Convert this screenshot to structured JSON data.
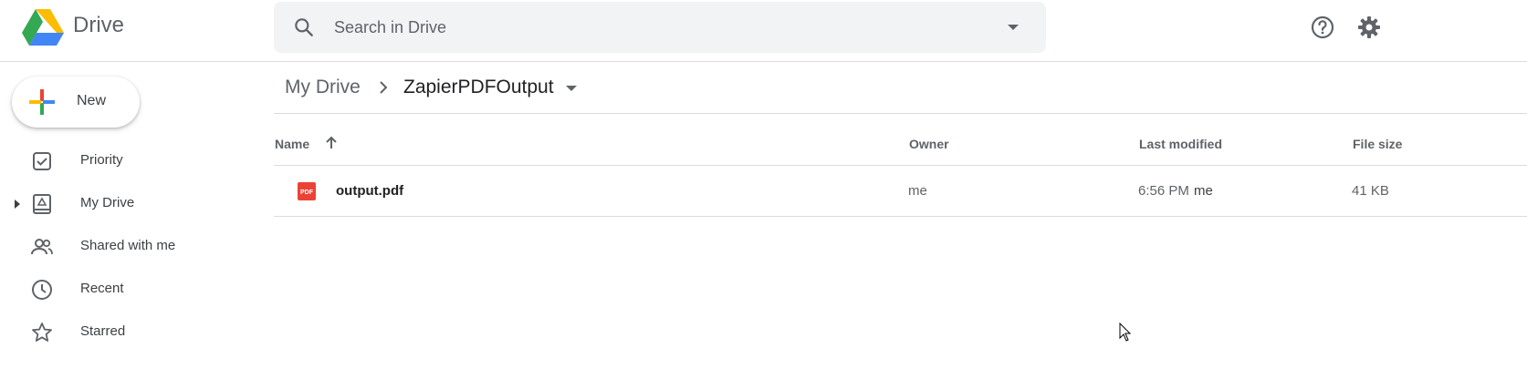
{
  "header": {
    "app_name": "Drive",
    "search_placeholder": "Search in Drive",
    "icons": [
      "drive-logo",
      "search-icon",
      "search-options-icon",
      "help-icon",
      "gear-icon"
    ]
  },
  "sidebar": {
    "new_label": "New",
    "items": [
      {
        "label": "Priority",
        "icon": "priority-icon"
      },
      {
        "label": "My Drive",
        "icon": "my-drive-icon"
      },
      {
        "label": "Shared with me",
        "icon": "shared-icon"
      },
      {
        "label": "Recent",
        "icon": "recent-icon"
      },
      {
        "label": "Starred",
        "icon": "star-icon"
      }
    ]
  },
  "breadcrumb": {
    "root": "My Drive",
    "current": "ZapierPDFOutput"
  },
  "table": {
    "columns": {
      "name": "Name",
      "owner": "Owner",
      "last_modified": "Last modified",
      "file_size": "File size"
    },
    "rows": [
      {
        "name": "output.pdf",
        "owner": "me",
        "modified_time": "6:56 PM",
        "modified_by": "me",
        "size": "41 KB",
        "icon_text": "PDF"
      }
    ]
  },
  "colors": {
    "accent_red": "#ea4335",
    "accent_blue": "#4285f4",
    "accent_yellow": "#fbbc04",
    "accent_green": "#34a853"
  }
}
